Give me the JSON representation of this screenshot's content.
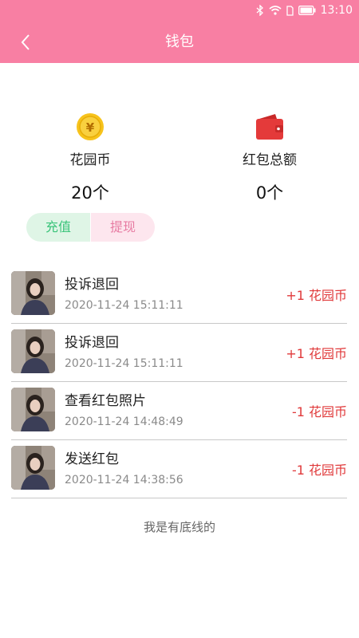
{
  "status_bar": {
    "time": "13:10",
    "icons": [
      "bluetooth-icon",
      "wifi-icon",
      "sim-icon",
      "battery-icon"
    ]
  },
  "header": {
    "title": "钱包",
    "back_icon": "chevron-left-icon"
  },
  "summary": {
    "coins": {
      "icon": "coin-icon",
      "label": "花园币",
      "value": "20个"
    },
    "redpacket": {
      "icon": "wallet-icon",
      "label": "红包总额",
      "value": "0个"
    }
  },
  "actions": {
    "recharge": "充值",
    "withdraw": "提现"
  },
  "transactions": [
    {
      "title": "投诉退回",
      "time": "2020-11-24 15:11:11",
      "amount": "+1 花园币"
    },
    {
      "title": "投诉退回",
      "time": "2020-11-24 15:11:11",
      "amount": "+1 花园币"
    },
    {
      "title": "查看红包照片",
      "time": "2020-11-24 14:48:49",
      "amount": "-1 花园币"
    },
    {
      "title": "发送红包",
      "time": "2020-11-24 14:38:56",
      "amount": "-1 花园币"
    }
  ],
  "footer": {
    "text": "我是有底线的"
  },
  "colors": {
    "accent": "#f87fa3",
    "positive": "#3ac47a",
    "amount": "#e0393a"
  }
}
